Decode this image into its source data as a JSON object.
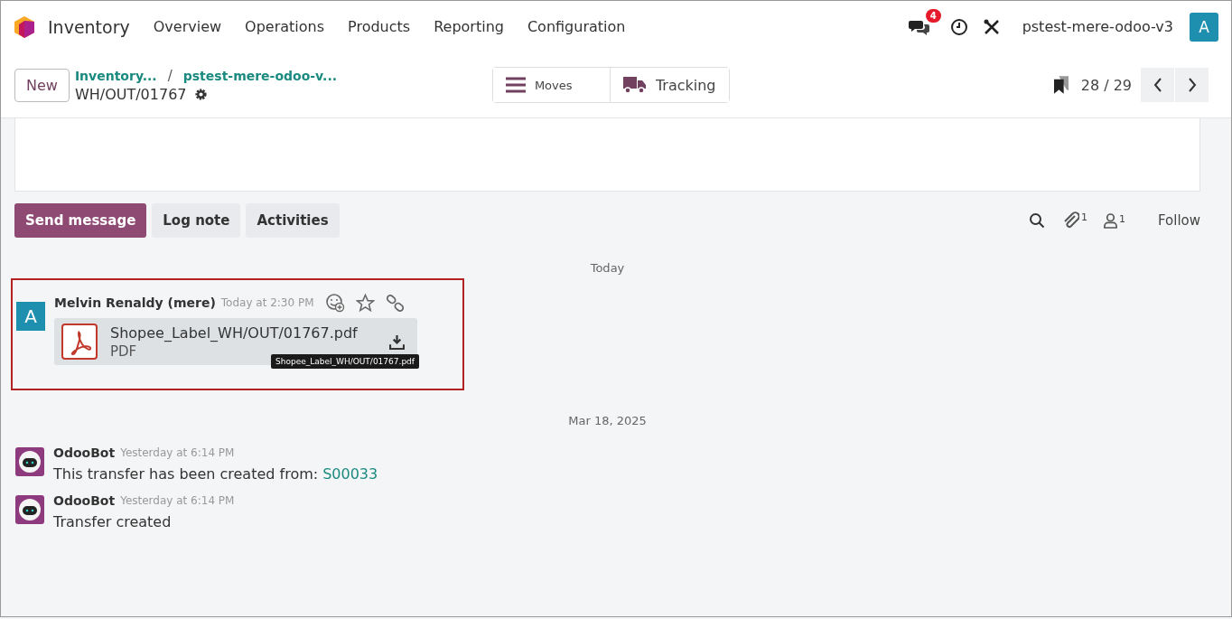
{
  "navbar": {
    "app": "Inventory",
    "menu": [
      "Overview",
      "Operations",
      "Products",
      "Reporting",
      "Configuration"
    ],
    "messages_badge": "4",
    "database": "pstest-mere-odoo-v3",
    "user_initial": "A"
  },
  "control_panel": {
    "new_button": "New",
    "breadcrumbs": [
      "Inventory...",
      "pstest-mere-odoo-v..."
    ],
    "breadcrumb_separator": "/",
    "record": "WH/OUT/01767",
    "smart_buttons": [
      {
        "kind": "list",
        "label": "Moves"
      },
      {
        "kind": "truck",
        "label": "Tracking"
      }
    ],
    "pager": "28 / 29"
  },
  "chatter": {
    "buttons": [
      {
        "label": "Send message",
        "selected": true
      },
      {
        "label": "Log note",
        "selected": false
      },
      {
        "label": "Activities",
        "selected": false
      }
    ],
    "attachments_count": "1",
    "followers_count": "1",
    "follow": "Follow"
  },
  "groups": [
    {
      "date": "Today",
      "messages": [
        {
          "kind": "letter",
          "initial": "A",
          "author": "Melvin Renaldy (mere)",
          "time": "Today at 2:30 PM",
          "highlighted": true,
          "attachment": {
            "name": "Shopee_Label_WH/OUT/01767.pdf",
            "type": "PDF",
            "tooltip": "Shopee_Label_WH/OUT/01767.pdf"
          }
        }
      ]
    },
    {
      "date": "Mar 18, 2025",
      "messages": [
        {
          "kind": "bot",
          "author": "OdooBot",
          "time": "Yesterday at 6:14 PM",
          "highlighted": false,
          "body": "This transfer has been created from:",
          "link": "S00033"
        },
        {
          "kind": "bot",
          "author": "OdooBot",
          "time": "Yesterday at 6:14 PM",
          "highlighted": false,
          "body": "Transfer created"
        }
      ]
    }
  ]
}
